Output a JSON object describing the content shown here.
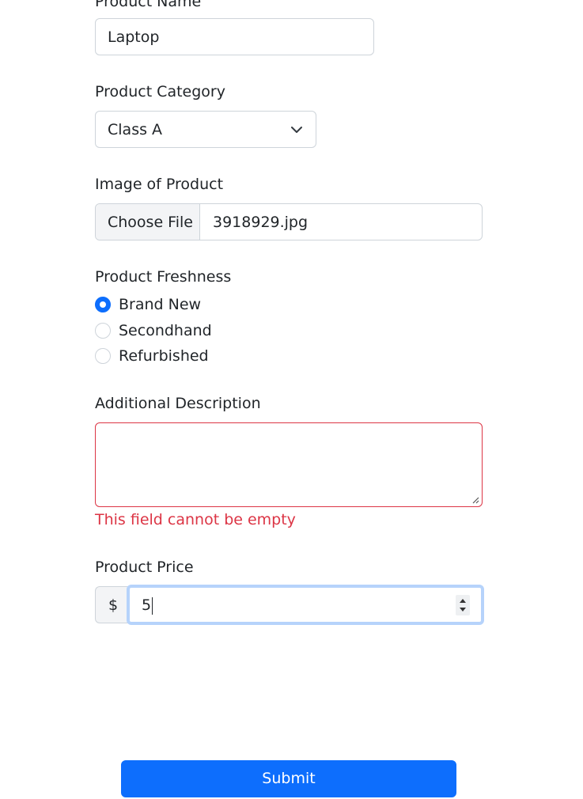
{
  "form": {
    "product_name": {
      "label": "Product Name",
      "value": "Laptop"
    },
    "product_category": {
      "label": "Product Category",
      "selected": "Class A",
      "icon": "chevron-down-icon"
    },
    "product_image": {
      "label": "Image of Product",
      "button_label": "Choose File",
      "file_name": "3918929.jpg"
    },
    "product_freshness": {
      "label": "Product Freshness",
      "options": [
        {
          "label": "Brand New",
          "checked": true
        },
        {
          "label": "Secondhand",
          "checked": false
        },
        {
          "label": "Refurbished",
          "checked": false
        }
      ]
    },
    "additional_description": {
      "label": "Additional Description",
      "value": "",
      "error": "This field cannot be empty"
    },
    "product_price": {
      "label": "Product Price",
      "prefix": "$",
      "value": "5"
    },
    "submit_label": "Submit"
  },
  "colors": {
    "primary": "#0d6efd",
    "error": "#dc3545",
    "focus_ring": "#b6d3fb",
    "border": "#ced4da",
    "addon_bg": "#f3f4f6"
  }
}
